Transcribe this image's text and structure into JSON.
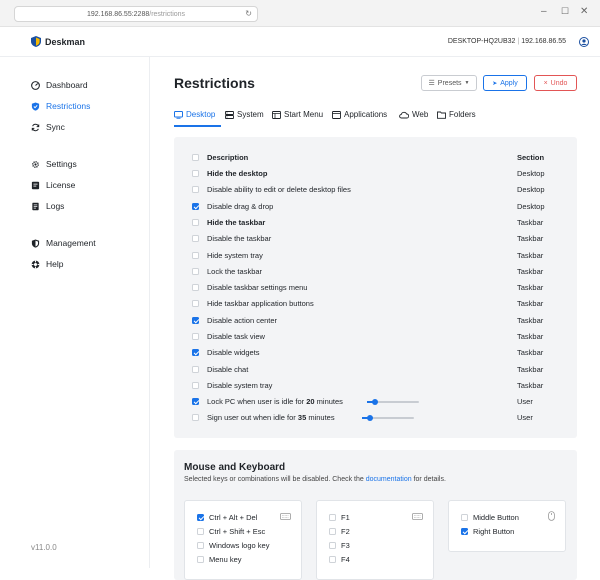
{
  "browser": {
    "url_host": "192.168.86.55:2288",
    "url_path": "/restrictions"
  },
  "app": {
    "name": "Deskman",
    "hostname": "DESKTOP-HQ2UB32",
    "ip": "192.168.86.55",
    "version": "v11.0.0"
  },
  "sidebar": {
    "items": [
      {
        "label": "Dashboard",
        "icon": "dashboard-icon"
      },
      {
        "label": "Restrictions",
        "icon": "shield-icon",
        "active": true
      },
      {
        "label": "Sync",
        "icon": "sync-icon"
      },
      {
        "label": "Settings",
        "icon": "gear-icon"
      },
      {
        "label": "License",
        "icon": "license-icon"
      },
      {
        "label": "Logs",
        "icon": "logs-icon"
      },
      {
        "label": "Management",
        "icon": "management-icon"
      },
      {
        "label": "Help",
        "icon": "help-icon"
      }
    ]
  },
  "page": {
    "title": "Restrictions"
  },
  "toolbar": {
    "presets_label": "Presets",
    "apply_label": "Apply",
    "undo_label": "Undo"
  },
  "tabs": [
    {
      "label": "Desktop",
      "active": true
    },
    {
      "label": "System"
    },
    {
      "label": "Start Menu"
    },
    {
      "label": "Applications"
    },
    {
      "label": "Web"
    },
    {
      "label": "Folders"
    }
  ],
  "table": {
    "col_description": "Description",
    "col_section": "Section",
    "rows": [
      {
        "desc": "Hide the desktop",
        "section": "Desktop",
        "checked": false,
        "bold": true
      },
      {
        "desc": "Disable ability to edit or delete desktop files",
        "section": "Desktop",
        "checked": false
      },
      {
        "desc": "Disable drag & drop",
        "section": "Desktop",
        "checked": true
      },
      {
        "desc": "Hide the taskbar",
        "section": "Taskbar",
        "checked": false,
        "bold": true
      },
      {
        "desc": "Disable the taskbar",
        "section": "Taskbar",
        "checked": false
      },
      {
        "desc": "Hide system tray",
        "section": "Taskbar",
        "checked": false
      },
      {
        "desc": "Lock the taskbar",
        "section": "Taskbar",
        "checked": false
      },
      {
        "desc": "Disable taskbar settings menu",
        "section": "Taskbar",
        "checked": false
      },
      {
        "desc": "Hide taskbar application buttons",
        "section": "Taskbar",
        "checked": false
      },
      {
        "desc": "Disable action center",
        "section": "Taskbar",
        "checked": true
      },
      {
        "desc": "Disable task view",
        "section": "Taskbar",
        "checked": false
      },
      {
        "desc": "Disable widgets",
        "section": "Taskbar",
        "checked": true
      },
      {
        "desc": "Disable chat",
        "section": "Taskbar",
        "checked": false
      },
      {
        "desc": "Disable system tray",
        "section": "Taskbar",
        "checked": false
      }
    ],
    "idle_lock": {
      "prefix": "Lock PC when user is idle for",
      "value": "20",
      "unit": "minutes",
      "section": "User",
      "checked": true,
      "slider_fraction": 0.15
    },
    "idle_signout": {
      "prefix": "Sign user out when idle for",
      "value": "35",
      "unit": "minutes",
      "section": "User",
      "checked": false,
      "slider_fraction": 0.15
    }
  },
  "mouse_keyboard": {
    "title": "Mouse and Keyboard",
    "desc_before": "Selected keys or combinations will be disabled. Check the",
    "desc_link": "documentation",
    "desc_after": "for details.",
    "keys_col1": [
      {
        "label": "Ctrl + Alt + Del",
        "checked": true
      },
      {
        "label": "Ctrl + Shift + Esc",
        "checked": false
      },
      {
        "label": "Windows logo key",
        "checked": false
      },
      {
        "label": "Menu key",
        "checked": false
      }
    ],
    "keys_col2": [
      {
        "label": "F1",
        "checked": false
      },
      {
        "label": "F2",
        "checked": false
      },
      {
        "label": "F3",
        "checked": false
      },
      {
        "label": "F4",
        "checked": false
      }
    ],
    "mouse": [
      {
        "label": "Middle Button",
        "checked": false
      },
      {
        "label": "Right Button",
        "checked": true
      }
    ]
  },
  "colors": {
    "accent": "#1a73e8",
    "danger": "#e25555",
    "panel_bg": "#f3f4f6"
  }
}
